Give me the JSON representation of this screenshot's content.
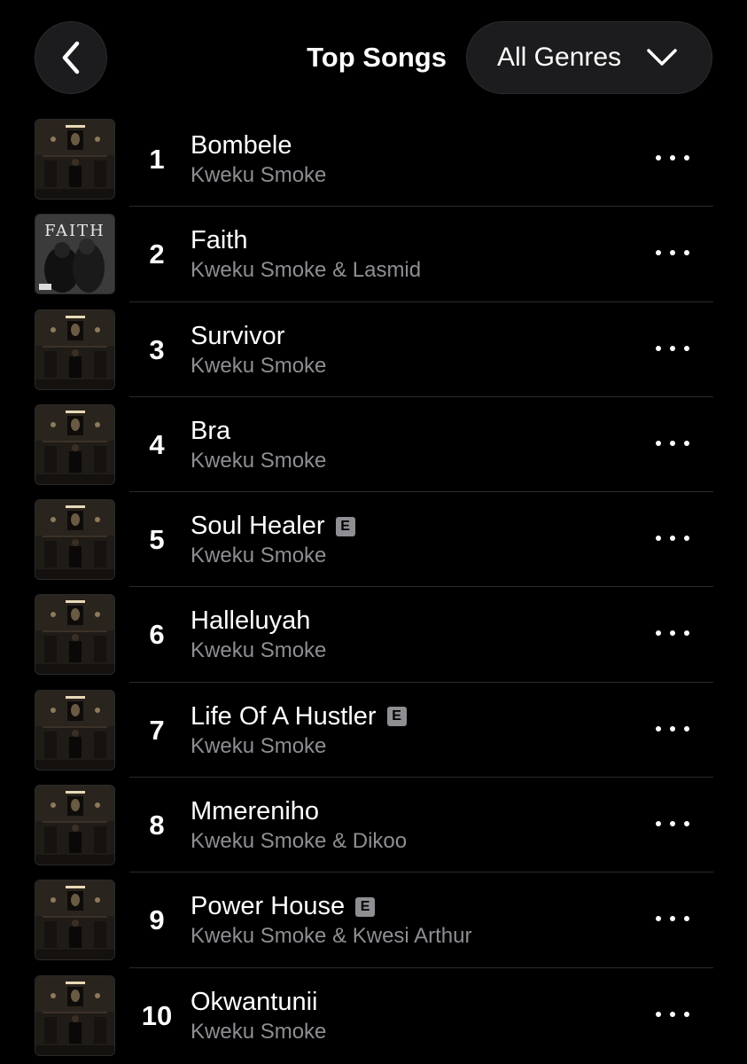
{
  "header": {
    "title": "Top Songs",
    "genre_label": "All Genres",
    "back_icon": "chevron-left-icon",
    "genre_icon": "chevron-down-icon"
  },
  "songs": [
    {
      "rank": "1",
      "title": "Bombele",
      "artist": "Kweku Smoke",
      "explicit": false,
      "art": "album-dark-room"
    },
    {
      "rank": "2",
      "title": "Faith",
      "artist": "Kweku Smoke & Lasmid",
      "explicit": false,
      "art": "album-faith",
      "art_text": "FAITH"
    },
    {
      "rank": "3",
      "title": "Survivor",
      "artist": "Kweku Smoke",
      "explicit": false,
      "art": "album-dark-room"
    },
    {
      "rank": "4",
      "title": "Bra",
      "artist": "Kweku Smoke",
      "explicit": false,
      "art": "album-dark-room"
    },
    {
      "rank": "5",
      "title": "Soul Healer",
      "artist": "Kweku Smoke",
      "explicit": true,
      "art": "album-dark-room"
    },
    {
      "rank": "6",
      "title": "Halleluyah",
      "artist": "Kweku Smoke",
      "explicit": false,
      "art": "album-dark-room"
    },
    {
      "rank": "7",
      "title": "Life Of A Hustler",
      "artist": "Kweku Smoke",
      "explicit": true,
      "art": "album-dark-room"
    },
    {
      "rank": "8",
      "title": "Mmereniho",
      "artist": "Kweku Smoke & Dikoo",
      "explicit": false,
      "art": "album-dark-room"
    },
    {
      "rank": "9",
      "title": "Power House",
      "artist": "Kweku Smoke & Kwesi Arthur",
      "explicit": true,
      "art": "album-dark-room"
    },
    {
      "rank": "10",
      "title": "Okwantunii",
      "artist": "Kweku Smoke",
      "explicit": false,
      "art": "album-dark-room"
    }
  ],
  "explicit_label": "E",
  "more_icon": "more-horizontal-icon",
  "colors": {
    "background": "#000000",
    "button_bg": "#1c1c1e",
    "secondary_text": "#8e8e93",
    "divider": "#2a2a2c"
  }
}
